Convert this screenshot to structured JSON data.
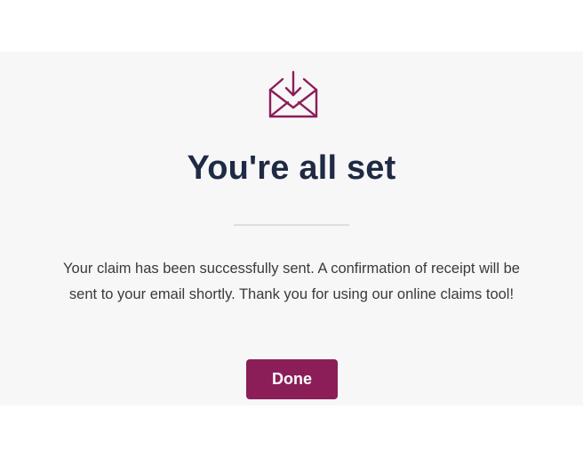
{
  "confirmation": {
    "icon": "envelope-download-icon",
    "title": "You're all set",
    "message_line1": "Your claim has been successfully sent. A confirmation of receipt will be",
    "message_line2": "sent to your email shortly. Thank you for using our online claims tool!",
    "done_label": "Done"
  },
  "colors": {
    "accent": "#8b1e59",
    "title": "#1f2a44",
    "panel_background": "#f7f7f7"
  }
}
